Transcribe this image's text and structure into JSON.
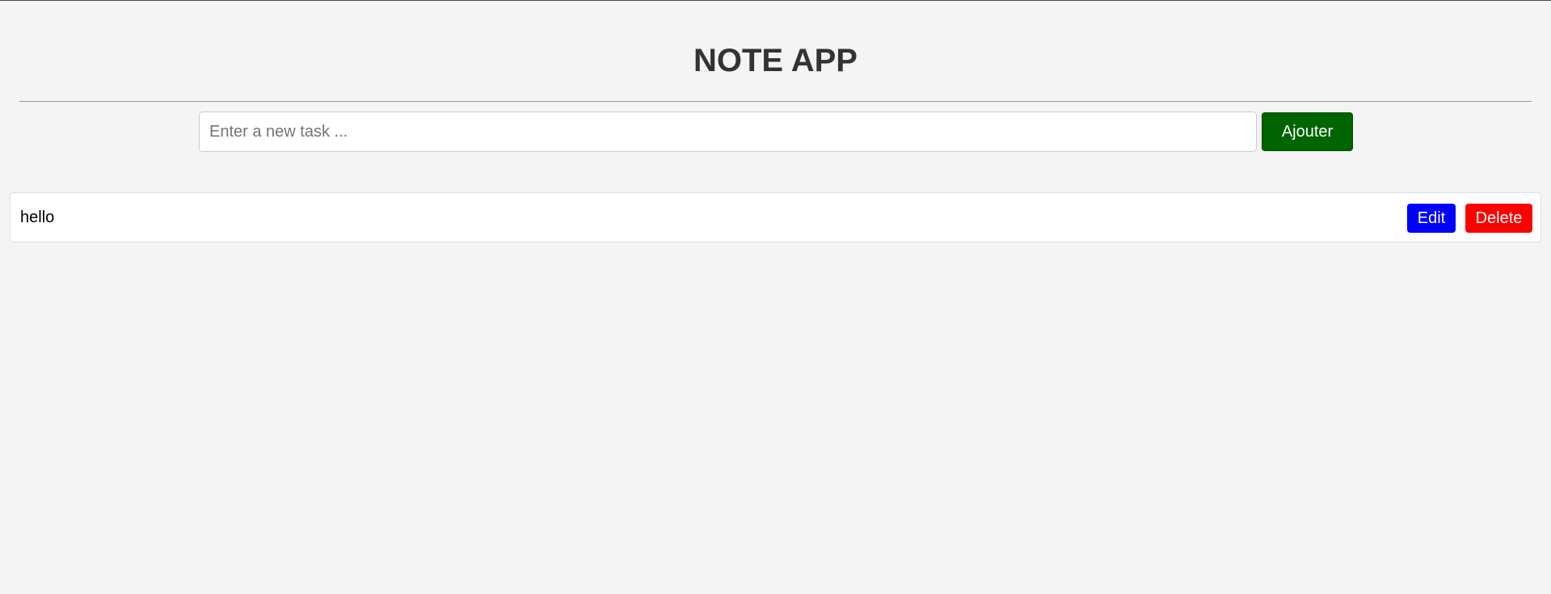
{
  "header": {
    "title": "NOTE APP"
  },
  "form": {
    "placeholder": "Enter a new task ...",
    "value": "",
    "add_label": "Ajouter"
  },
  "tasks": [
    {
      "text": "hello",
      "edit_label": "Edit",
      "delete_label": "Delete"
    }
  ],
  "colors": {
    "background": "#f4f4f4",
    "title": "#333333",
    "add_button": "#006400",
    "edit_button": "#0000ff",
    "delete_button": "#ff0000"
  }
}
